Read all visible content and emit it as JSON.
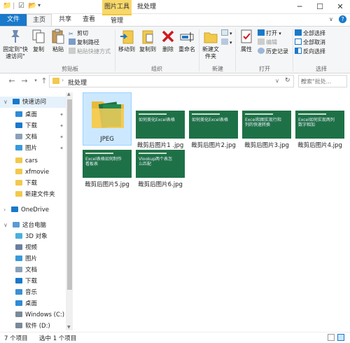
{
  "window": {
    "context_tab": "图片工具",
    "title": "批处理",
    "minimize": "─",
    "maximize": "☐",
    "close": "✕"
  },
  "ribbon_tabs": [
    "文件",
    "主页",
    "共享",
    "查看",
    "管理"
  ],
  "ribbon": {
    "clipboard": {
      "pin": "固定到\"\n快速访问\"",
      "pin_label": "固定到\"快速访问\"",
      "copy": "复制",
      "paste": "粘贴",
      "cut": "剪切",
      "copy_path": "复制路径",
      "paste_shortcut": "粘贴快捷方式",
      "group": "剪贴板"
    },
    "organize": {
      "move_to": "移动到",
      "copy_to": "复制到",
      "delete": "删除",
      "rename": "重命名",
      "group": "组织"
    },
    "new": {
      "new_folder": "新建\n文件夹",
      "new_folder_label": "新建文件夹",
      "group": "新建"
    },
    "open": {
      "properties": "属性",
      "open": "打开",
      "edit": "编辑",
      "history": "历史记录",
      "group": "打开"
    },
    "select": {
      "select_all": "全部选择",
      "select_none": "全部取消",
      "invert": "反向选择",
      "group": "选择"
    }
  },
  "nav": {
    "back": "←",
    "forward": "→",
    "up": "↑",
    "path": "批处理",
    "search_placeholder": "搜索\"批处...",
    "refresh": "↻"
  },
  "sidebar": {
    "items": [
      {
        "label": "快速访问",
        "icon": "star-icon",
        "pinned": false
      },
      {
        "label": "桌面",
        "icon": "desktop-icon",
        "pinned": true
      },
      {
        "label": "下载",
        "icon": "download-icon",
        "pinned": true
      },
      {
        "label": "文档",
        "icon": "document-icon",
        "pinned": true
      },
      {
        "label": "图片",
        "icon": "picture-icon",
        "pinned": true
      },
      {
        "label": "cars",
        "icon": "folder-icon",
        "pinned": false
      },
      {
        "label": "xfmovie",
        "icon": "folder-icon",
        "pinned": false
      },
      {
        "label": "下载",
        "icon": "folder-icon",
        "pinned": false
      },
      {
        "label": "新建文件夹",
        "icon": "folder-icon",
        "pinned": false
      },
      {
        "label": "OneDrive",
        "icon": "cloud-icon",
        "pinned": false
      },
      {
        "label": "这台电脑",
        "icon": "computer-icon",
        "pinned": false
      },
      {
        "label": "3D 对象",
        "icon": "3d-objects-icon",
        "pinned": false
      },
      {
        "label": "视频",
        "icon": "video-icon",
        "pinned": false
      },
      {
        "label": "图片",
        "icon": "picture-icon",
        "pinned": false
      },
      {
        "label": "文档",
        "icon": "document-icon",
        "pinned": false
      },
      {
        "label": "下载",
        "icon": "download-icon",
        "pinned": false
      },
      {
        "label": "音乐",
        "icon": "music-icon",
        "pinned": false
      },
      {
        "label": "桌面",
        "icon": "desktop-icon",
        "pinned": false
      },
      {
        "label": "Windows (C:)",
        "icon": "drive-icon",
        "pinned": false
      },
      {
        "label": "软件 (D:)",
        "icon": "drive-icon",
        "pinned": false
      }
    ]
  },
  "files": [
    {
      "name": "JPEG",
      "type": "folder",
      "selected": true
    },
    {
      "name": "裁剪后图片1 .jpg",
      "type": "image",
      "thumb_text": "如何美化Excel表格"
    },
    {
      "name": "裁剪后图片2.jpg",
      "type": "image",
      "thumb_text": "如何美化Excel表格"
    },
    {
      "name": "裁剪后图片3.jpg",
      "type": "image",
      "thumb_text": "Excel和图实现行和列的快速转换"
    },
    {
      "name": "裁剪后图片4.jpg",
      "type": "image",
      "thumb_text": "Excel如何实现两列数字相加"
    },
    {
      "name": "裁剪后图片5.jpg",
      "type": "image",
      "thumb_text": "Excel表格如何制作看板表"
    },
    {
      "name": "裁剪后图片6.jpg",
      "type": "image",
      "thumb_text": "Vlookup两个表怎么匹配"
    }
  ],
  "status": {
    "count": "7 个项目",
    "selected": "选中 1 个项目"
  },
  "colors": {
    "accent": "#1979ca",
    "folder": "#f2c94c",
    "thumb_green": "#1e7146",
    "selection": "#cce8ff"
  }
}
